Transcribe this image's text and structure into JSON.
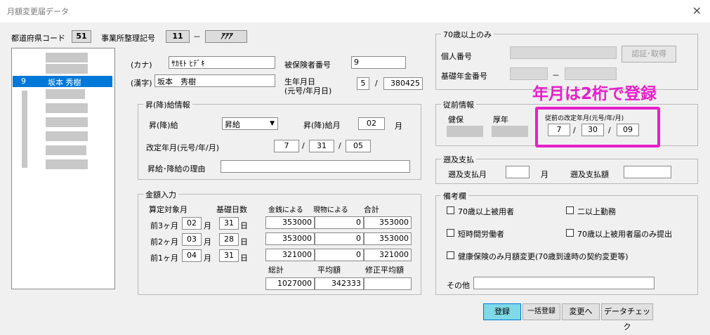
{
  "window": {
    "title": "月額変更届データ",
    "close_icon": "close-icon"
  },
  "header": {
    "pref_code_label": "都道府県コード",
    "pref_code_value": "51",
    "office_label": "事業所整理記号",
    "office_code1": "11",
    "office_dash": "－",
    "office_code2": "ｱｱｱ"
  },
  "employee_list": {
    "selected_number": "9",
    "selected_name": "坂本 秀樹"
  },
  "person": {
    "kana_label": "(カナ)",
    "kana_value": "ｻｶﾓﾄ ﾋﾃﾞｷ",
    "kanji_label": "(漢字)",
    "kanji_value": "坂本　秀樹",
    "insured_no_label": "被保険者番号",
    "insured_no_value": "9",
    "birth_label_1": "生年月日",
    "birth_label_2": "(元号/年月日)",
    "birth_era": "5",
    "birth_sep": "/",
    "birth_date": "380425"
  },
  "raise": {
    "group_title": "昇(降)給情報",
    "type_label": "昇(降)給",
    "type_value": "昇給",
    "month_label": "昇(降)給月",
    "month_value": "02",
    "month_unit": "月",
    "revision_label": "改定年月(元号/年/月)",
    "rev_era": "7",
    "rev_year": "31",
    "rev_month": "05",
    "sep": "/",
    "reason_label": "昇給･降給の理由",
    "reason_value": ""
  },
  "amounts": {
    "group_title": "金額入力",
    "target_month_label": "算定対象月",
    "base_days_label": "基礎日数",
    "currency_label": "金銭による",
    "in_kind_label": "現物による",
    "total_label": "合計",
    "month_unit": "月",
    "day_unit": "日",
    "rows": [
      {
        "label": "前3ヶ月",
        "month": "02",
        "days": "31",
        "currency": "353000",
        "in_kind": "0",
        "total": "353000"
      },
      {
        "label": "前2ヶ月",
        "month": "03",
        "days": "28",
        "currency": "353000",
        "in_kind": "0",
        "total": "353000"
      },
      {
        "label": "前1ヶ月",
        "month": "04",
        "days": "31",
        "currency": "321000",
        "in_kind": "0",
        "total": "321000"
      }
    ],
    "grand_total_label": "総計",
    "average_label": "平均額",
    "adjusted_average_label": "修正平均額",
    "grand_total": "1027000",
    "average": "342333",
    "adjusted_average": ""
  },
  "over70": {
    "group_title": "70歳以上のみ",
    "my_number_label": "個人番号",
    "pension_no_label": "基礎年金番号",
    "pension_dash": "－",
    "auth_button": "認証･取得"
  },
  "previous": {
    "group_title": "従前情報",
    "health_label": "健保",
    "pension_label": "厚年",
    "prev_revision_label": "従前の改定年月(元号/年/月)",
    "era": "7",
    "year": "30",
    "month": "09",
    "sep": "/"
  },
  "annotation": {
    "text": "年月は2桁で登録",
    "color": "#e81ecb"
  },
  "retro": {
    "group_title": "遡及支払",
    "month_label": "遡及支払月",
    "month_value": "",
    "month_unit": "月",
    "amount_label": "遡及支払額",
    "amount_value": ""
  },
  "remarks": {
    "group_title": "備考欄",
    "over70_employee": "70歳以上被用者",
    "multi_office": "二以上勤務",
    "short_time": "短時間労働者",
    "over70_only": "70歳以上被用者届のみ提出",
    "health_only": "健康保険のみ月額変更(70歳到達時の契約変更等)",
    "other_label": "その他",
    "other_value": ""
  },
  "buttons": {
    "register": "登録",
    "bulk_register": "一括登録",
    "change": "変更へ",
    "data_check": "データチェック"
  }
}
